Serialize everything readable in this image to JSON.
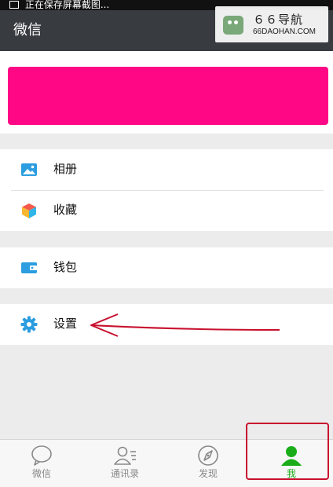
{
  "status_bar": {
    "text": "正在保存屏幕截图..."
  },
  "header": {
    "title": "微信"
  },
  "watermark": {
    "title": "６６导航",
    "subtitle": "66DAOHAN.COM"
  },
  "profile": {
    "banner_color": "#ff0785"
  },
  "menu": {
    "album": {
      "label": "相册",
      "icon": "album-icon"
    },
    "favorites": {
      "label": "收藏",
      "icon": "favorites-cube-icon"
    },
    "wallet": {
      "label": "钱包",
      "icon": "wallet-icon"
    },
    "settings": {
      "label": "设置",
      "icon": "gear-icon"
    }
  },
  "tabs": [
    {
      "label": "微信",
      "icon": "chat-bubble-icon",
      "active": false
    },
    {
      "label": "通讯录",
      "icon": "contacts-icon",
      "active": false
    },
    {
      "label": "发现",
      "icon": "compass-icon",
      "active": false
    },
    {
      "label": "我",
      "icon": "person-icon",
      "active": true
    }
  ],
  "colors": {
    "title_bar": "#383b40",
    "accent_green": "#1aad19",
    "icon_blue": "#2b9de0",
    "annotation_red": "#c8102e"
  }
}
